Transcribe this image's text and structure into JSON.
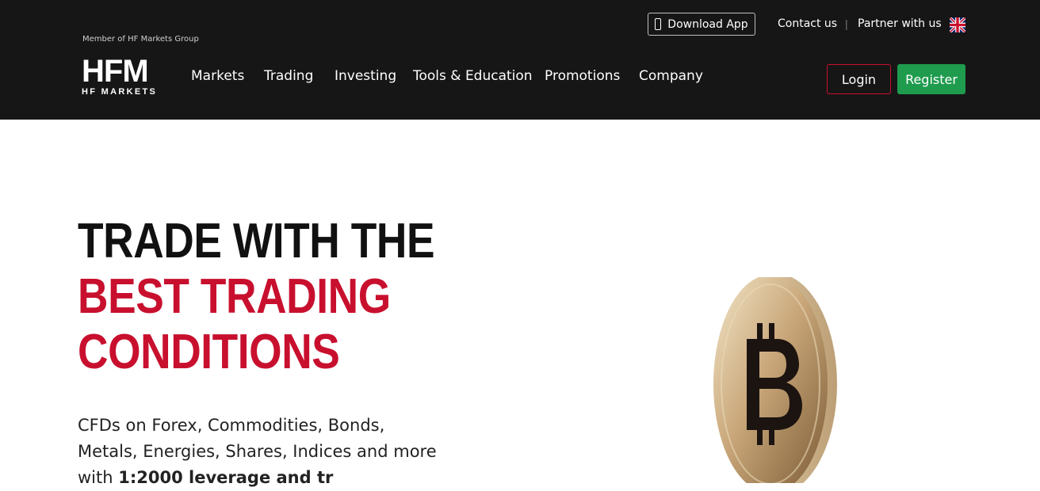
{
  "header": {
    "member_text": "Member of HF Markets Group",
    "logo_letters": "HFM",
    "logo_subtitle": "HF MARKETS",
    "download_label": "Download App",
    "contact_label": "Contact us",
    "separator": "|",
    "partner_label": "Partner with us",
    "login_label": "Login",
    "register_label": "Register",
    "language_flag": "uk-flag-icon",
    "nav": [
      {
        "label": "Markets"
      },
      {
        "label": "Trading"
      },
      {
        "label": "Investing"
      },
      {
        "label": "Tools & Education"
      },
      {
        "label": "Promotions"
      },
      {
        "label": "Company"
      }
    ]
  },
  "hero": {
    "line1": "TRADE WITH THE",
    "line2": "BEST TRADING",
    "line3": "CONDITIONS",
    "description_line1": "CFDs on Forex, Commodities, Bonds,",
    "description_line2": "Metals, Energies, Shares, Indices and more",
    "description_line3_prefix": "with",
    "description_line3_bold": "1:2000 leverage and tr"
  },
  "colors": {
    "header_bg": "#161616",
    "brand_red": "#c8102e",
    "register_green": "#1f9b4e"
  }
}
